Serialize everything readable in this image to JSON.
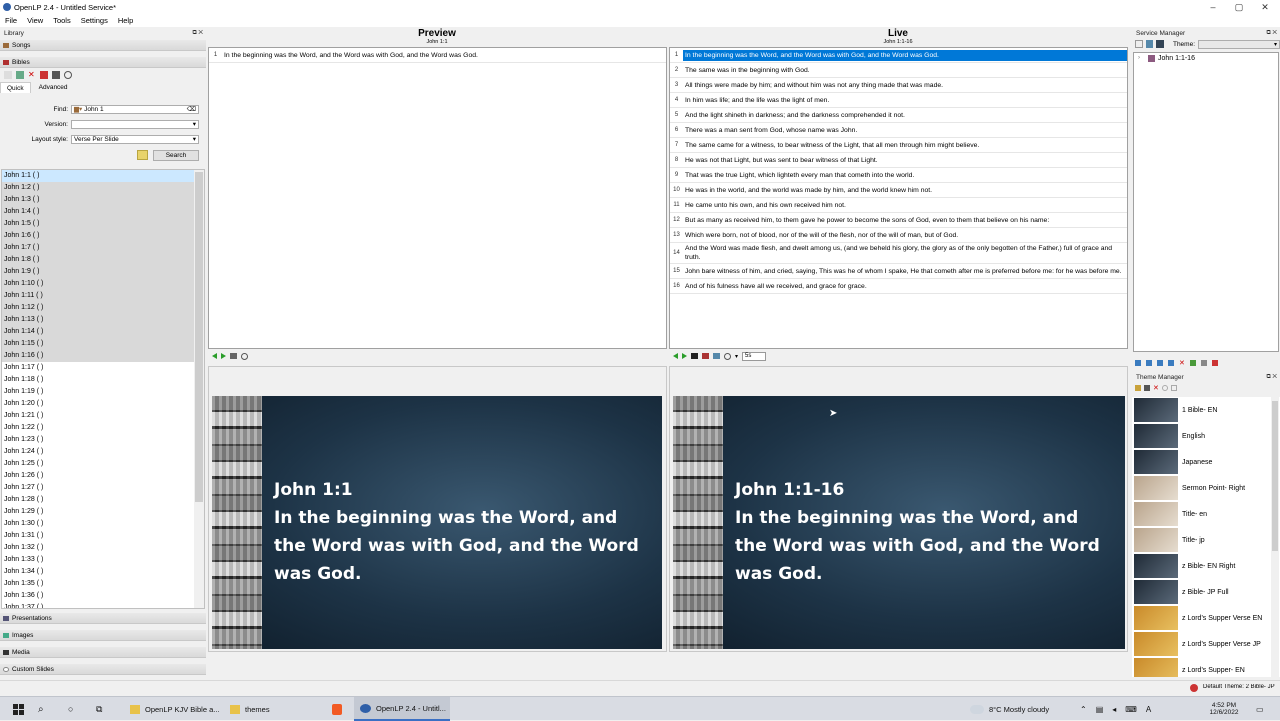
{
  "window": {
    "title": "OpenLP 2.4 - Untitled Service*"
  },
  "menu": [
    "File",
    "View",
    "Tools",
    "Settings",
    "Help"
  ],
  "library": {
    "header": "Library",
    "sections": {
      "songs": "Songs",
      "bibles": "Bibles",
      "presentations": "Presentations",
      "images": "Images",
      "media": "Media",
      "custom": "Custom Slides"
    },
    "tabs": {
      "quick": "Quick",
      "advanced": "Advanced"
    },
    "find_label": "Find:",
    "find_value": "John 1",
    "version_label": "Version:",
    "version_value": "",
    "layout_label": "Layout style:",
    "layout_value": "Verse Per Slide",
    "search_button": "Search",
    "verses": [
      "John 1:1 ( )",
      "John 1:2 ( )",
      "John 1:3 ( )",
      "John 1:4 ( )",
      "John 1:5 ( )",
      "John 1:6 ( )",
      "John 1:7 ( )",
      "John 1:8 ( )",
      "John 1:9 ( )",
      "John 1:10 ( )",
      "John 1:11 ( )",
      "John 1:12 ( )",
      "John 1:13 ( )",
      "John 1:14 ( )",
      "John 1:15 ( )",
      "John 1:16 ( )",
      "John 1:17 ( )",
      "John 1:18 ( )",
      "John 1:19 ( )",
      "John 1:20 ( )",
      "John 1:21 ( )",
      "John 1:22 ( )",
      "John 1:23 ( )",
      "John 1:24 ( )",
      "John 1:25 ( )",
      "John 1:26 ( )",
      "John 1:27 ( )",
      "John 1:28 ( )",
      "John 1:29 ( )",
      "John 1:30 ( )",
      "John 1:31 ( )",
      "John 1:32 ( )",
      "John 1:33 ( )",
      "John 1:34 ( )",
      "John 1:35 ( )",
      "John 1:36 ( )",
      "John 1:37 ( )"
    ],
    "selected_count": 16
  },
  "preview": {
    "title": "Preview",
    "subtitle": "John 1:1",
    "rows": [
      {
        "n": "1",
        "t": "In the beginning was the Word, and the Word was with God, and the Word was God."
      }
    ],
    "slide_ref": "John 1:1",
    "slide_text": "In the beginning was the Word, and the Word was with God, and the Word was God."
  },
  "live": {
    "title": "Live",
    "subtitle": "John 1:1-16",
    "delay": "5s",
    "rows": [
      {
        "n": "1",
        "t": "In the beginning was the Word, and the Word was with God, and the Word was God."
      },
      {
        "n": "2",
        "t": "The same was in the beginning with God."
      },
      {
        "n": "3",
        "t": "All things were made by him; and without him was not any thing made that was made."
      },
      {
        "n": "4",
        "t": "In him was life; and the life was the light of men."
      },
      {
        "n": "5",
        "t": "And the light shineth in darkness; and the darkness comprehended it not."
      },
      {
        "n": "6",
        "t": "There was a man sent from God, whose name was John."
      },
      {
        "n": "7",
        "t": "The same came for a witness, to bear witness of the Light, that all men through him might believe."
      },
      {
        "n": "8",
        "t": "He was not that Light, but was sent to bear witness of that Light."
      },
      {
        "n": "9",
        "t": "That was the true Light, which lighteth every man that cometh into the world."
      },
      {
        "n": "10",
        "t": "He was in the world, and the world was made by him, and the world knew him not."
      },
      {
        "n": "11",
        "t": "He came unto his own, and his own received him not."
      },
      {
        "n": "12",
        "t": "But as many as received him, to them gave he power to become the sons of God, even to them that believe on his name:"
      },
      {
        "n": "13",
        "t": "Which were born, not of blood, nor of the will of the flesh, nor of the will of man, but of God."
      },
      {
        "n": "14",
        "t": "And the Word was made flesh, and dwelt among us, (and we beheld his glory, the glory as of the only begotten of the Father,) full of grace and truth."
      },
      {
        "n": "15",
        "t": "John bare witness of him, and cried, saying, This was he of whom I spake, He that cometh after me is preferred before me: for he was before me."
      },
      {
        "n": "16",
        "t": "And of his fulness have all we received, and grace for grace."
      }
    ],
    "slide_ref": "John 1:1-16",
    "slide_text": "In the beginning was the Word, and the Word was with God, and the Word was God."
  },
  "service_manager": {
    "header": "Service Manager",
    "theme_label": "Theme:",
    "item": "John 1:1-16"
  },
  "theme_manager": {
    "header": "Theme Manager",
    "themes": [
      "1 Bible- EN",
      "English",
      "Japanese",
      "Sermon Point- Right",
      "Title- en",
      "Title- jp",
      "z Bible- EN Right",
      "z Bible- JP Full",
      "z Lord's Supper Verse EN",
      "z Lord's Supper Verse JP",
      "z Lord's Supper- EN"
    ],
    "default_theme": "Default Theme: 2 Bible- JP"
  },
  "taskbar": {
    "apps": [
      "OpenLP KJV Bible a...",
      "themes",
      "OpenLP 2.4 - Untitl..."
    ],
    "weather": "8°C  Mostly cloudy",
    "time": "4:52 PM",
    "date": "12/6/2022"
  },
  "colors": {
    "selection": "#0078d7",
    "accent": "#2f5fa8"
  }
}
